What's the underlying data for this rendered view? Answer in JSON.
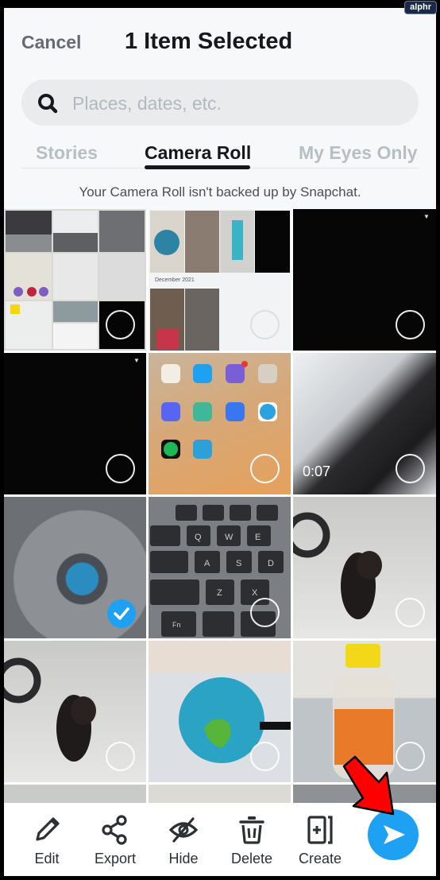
{
  "watermark": "alphr",
  "header": {
    "cancel_label": "Cancel",
    "title": "1 Item Selected"
  },
  "search": {
    "placeholder": "Places, dates, etc.",
    "value": ""
  },
  "tabs": [
    {
      "label": "Stories",
      "active": false
    },
    {
      "label": "Camera Roll",
      "active": true
    },
    {
      "label": "My Eyes Only",
      "active": false
    }
  ],
  "notice": "Your Camera Roll isn't backed up by Snapchat.",
  "grid": {
    "items": [
      {
        "type": "screenshot-collage",
        "selected": false,
        "has_menu": false
      },
      {
        "type": "screenshot-collage",
        "selected": false,
        "has_menu": false,
        "caption": "December 2021"
      },
      {
        "type": "black-video",
        "selected": false,
        "has_menu": true
      },
      {
        "type": "black-video",
        "selected": false,
        "has_menu": true
      },
      {
        "type": "home-screen-screenshot",
        "selected": false,
        "has_menu": false,
        "apps": [
          "SIM Toolkit",
          "Twitter",
          "Viber",
          "My Apps",
          "Discord",
          "Contacts",
          "Signal",
          "Telegram",
          "Spotify",
          "Gallery"
        ]
      },
      {
        "type": "dog-video",
        "selected": false,
        "has_menu": false,
        "duration": "0:07"
      },
      {
        "type": "fan-photo",
        "selected": true,
        "has_menu": false
      },
      {
        "type": "keyboard-photo",
        "selected": false,
        "has_menu": false
      },
      {
        "type": "dog-photo",
        "selected": false,
        "has_menu": false
      },
      {
        "type": "dog-photo",
        "selected": false,
        "has_menu": false
      },
      {
        "type": "globe-photo",
        "selected": false,
        "has_menu": false
      },
      {
        "type": "bottle-photo",
        "selected": false,
        "has_menu": false
      }
    ]
  },
  "toolbar": {
    "items": [
      {
        "label": "Edit",
        "icon": "pencil-icon"
      },
      {
        "label": "Export",
        "icon": "share-icon"
      },
      {
        "label": "Hide",
        "icon": "eye-off-icon"
      },
      {
        "label": "Delete",
        "icon": "trash-icon"
      },
      {
        "label": "Create",
        "icon": "create-story-icon"
      }
    ],
    "send_icon": "send-icon"
  },
  "colors": {
    "accent": "#1ea1f2",
    "annotation_arrow": "#ff0000",
    "title": "#16191c",
    "muted": "#b9bec3"
  }
}
